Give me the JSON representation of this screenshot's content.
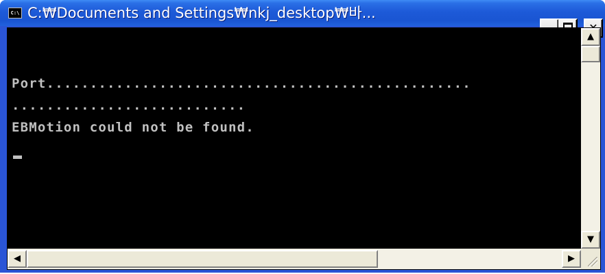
{
  "window": {
    "title": "C:₩Documents and Settings₩nkj_desktop₩바...",
    "icon": "console-icon",
    "icon_text": "C:\\",
    "controls": {
      "minimize": "minimize-icon",
      "maximize": "maximize-icon",
      "close": "close-icon",
      "close_glyph": "✕"
    }
  },
  "console": {
    "lines": [
      "Port.................................................",
      "...........................",
      "EBMotion could not be found."
    ],
    "text_color": "#c0c0c0",
    "background": "#000000"
  },
  "scrollbars": {
    "up_arrow": "▲",
    "down_arrow": "▼",
    "left_arrow": "◀",
    "right_arrow": "▶"
  },
  "colors": {
    "titlebar": "#1d5ad8",
    "frame": "#ece9d8"
  }
}
